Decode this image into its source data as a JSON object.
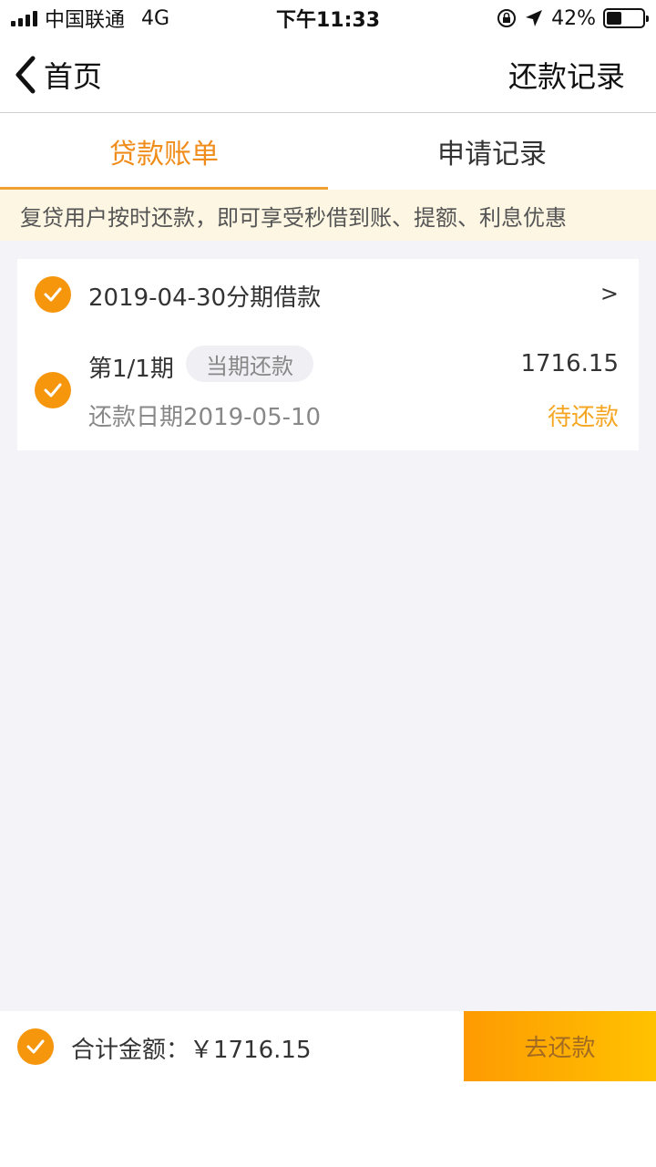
{
  "status_bar": {
    "carrier": "中国联通",
    "network": "4G",
    "time": "下午11:33",
    "battery_percent": "42%",
    "battery_level": 0.42
  },
  "nav": {
    "back_label": "首页",
    "right_label": "还款记录"
  },
  "tabs": [
    {
      "label": "贷款账单",
      "active": true
    },
    {
      "label": "申请记录",
      "active": false
    }
  ],
  "notice": "复贷用户按时还款，即可享受秒借到账、提额、利息优惠",
  "loan": {
    "title": "2019-04-30分期借款",
    "arrow": ">",
    "period": "第1/1期",
    "badge": "当期还款",
    "amount": "1716.15",
    "due_date": "还款日期2019-05-10",
    "status": "待还款"
  },
  "bottom": {
    "total_label": "合计金额：￥1716.15",
    "pay_button": "去还款"
  },
  "colors": {
    "accent": "#f5960d",
    "active_tab": "#f08c1a",
    "pending": "#f5a623"
  }
}
